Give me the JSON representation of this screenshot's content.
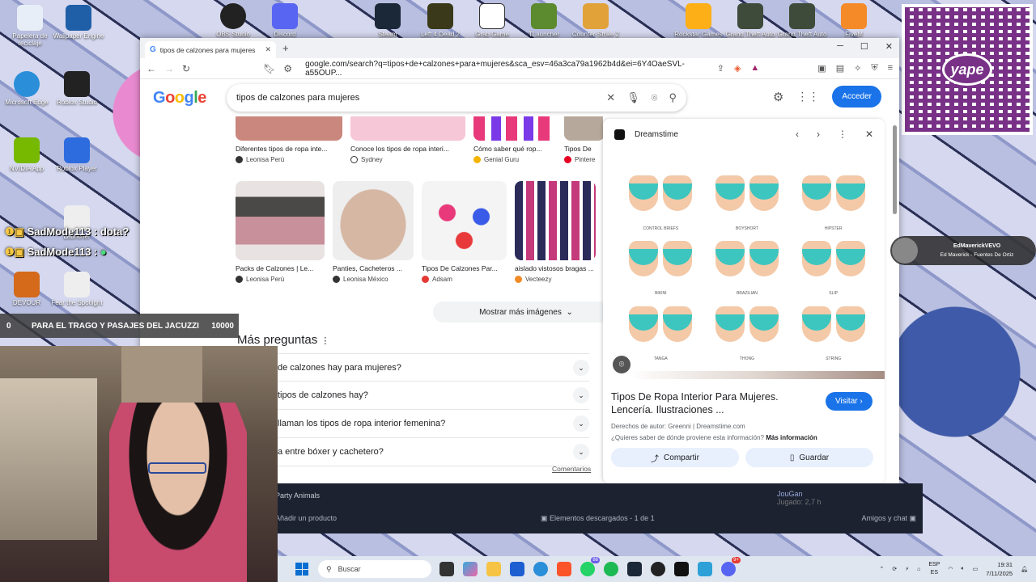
{
  "desktop_icons": [
    {
      "label": "Papelera de reciclaje",
      "color": "#e8eef7"
    },
    {
      "label": "Wallpaper Engine",
      "color": "#1f5fa8"
    },
    {
      "label": "Microsoft Edge",
      "color": "#2b8ed8"
    },
    {
      "label": "Roblox Studio",
      "color": "#222"
    },
    {
      "label": "NVIDIA App",
      "color": "#76b900"
    },
    {
      "label": "Roblox Player",
      "color": "#2d6cdf"
    },
    {
      "label": "Launcher",
      "color": "#eee"
    },
    {
      "label": "DEVOUR",
      "color": "#d46a1a"
    },
    {
      "label": "Fear the Spotlight",
      "color": "#eee"
    }
  ],
  "top_apps": [
    "OBS Studio",
    "Discord",
    "Steam",
    "Left 4 Dead 2",
    "Grab Game",
    "TLauncher",
    "Counter-Strike 2",
    "Rockstar Games",
    "Grand Theft Auto",
    "Grand Theft Auto",
    "FiveM"
  ],
  "qr": {
    "brand": "yape"
  },
  "browser": {
    "tab_title": "tipos de calzones para mujeres",
    "url": "google.com/search?q=tipos+de+calzones+para+mujeres&sca_esv=46a3ca79a1962b4d&ei=6Y4OaeSVL-a55OUP...",
    "search_query": "tipos de calzones para mujeres",
    "acceder_label": "Acceder"
  },
  "image_results_row1": [
    {
      "caption": "Diferentes tipos de ropa inte...",
      "source": "Leonisa Perú"
    },
    {
      "caption": "Conoce los tipos de ropa interi...",
      "source": "Sydney"
    },
    {
      "caption": "Cómo saber qué rop...",
      "source": "Genial Guru"
    },
    {
      "caption": "Tipos De",
      "source": "Pintere"
    }
  ],
  "image_results_row2": [
    {
      "caption": "Packs de Calzones | Le...",
      "source": "Leonisa Perú"
    },
    {
      "caption": "Panties, Cacheteros ...",
      "source": "Leonisa México"
    },
    {
      "caption": "Tipos De Calzones Par...",
      "source": "Adsam"
    },
    {
      "caption": "aislado vistosos bragas ...",
      "source": "Vecteezy"
    }
  ],
  "mostrar_mas": "Mostrar más imágenes",
  "mas_preguntas": "Más preguntas",
  "faqs": [
    "de calzones hay para mujeres?",
    "tipos de calzones hay?",
    "llaman los tipos de ropa interior femenina?",
    "a entre bóxer y cachetero?"
  ],
  "comentarios": "Comentarios",
  "panel": {
    "source": "Dreamstime",
    "image_labels": [
      "CONTROL BRIEFS",
      "BOYSHORT",
      "HIPSTER",
      "BIKINI",
      "BRAZILIAN",
      "SLIP",
      "TANGA",
      "THONG",
      "STRING"
    ],
    "title": "Tipos De Ropa Interior Para Mujeres. Lencería. Ilustraciones ...",
    "visitar": "Visitar",
    "credit": "Derechos de autor: Greenni | Dreamstime.com",
    "origin_q": "¿Quieres saber de dónde proviene esta información?",
    "mas_info": "Más información",
    "compartir": "Compartir",
    "guardar": "Guardar"
  },
  "steam": {
    "game1": "Party Animals",
    "add_product": "Añadir un producto",
    "downloads": "Elementos descargados - 1 de 1",
    "friends": "Amigos y chat",
    "friend_name": "JouGan",
    "friend_status": "Jugado: 2,7 h"
  },
  "overlay": {
    "chat_user": "SadMode113",
    "chat_msg": ": dota?",
    "goal_left": "0",
    "goal_text": "PARA EL TRAGO Y PASAJES DEL JACUZZI",
    "goal_right": "10000",
    "ed_name": "EdMaverickVEVO",
    "ed_song": "Ed Maverick - Fuentes De Ortiz"
  },
  "taskbar": {
    "search": "Buscar",
    "lang1": "ESP",
    "lang2": "ES",
    "time": "19:31",
    "date": "7/11/2025",
    "whatsapp_badge": "86",
    "discord_badge": "9+"
  }
}
